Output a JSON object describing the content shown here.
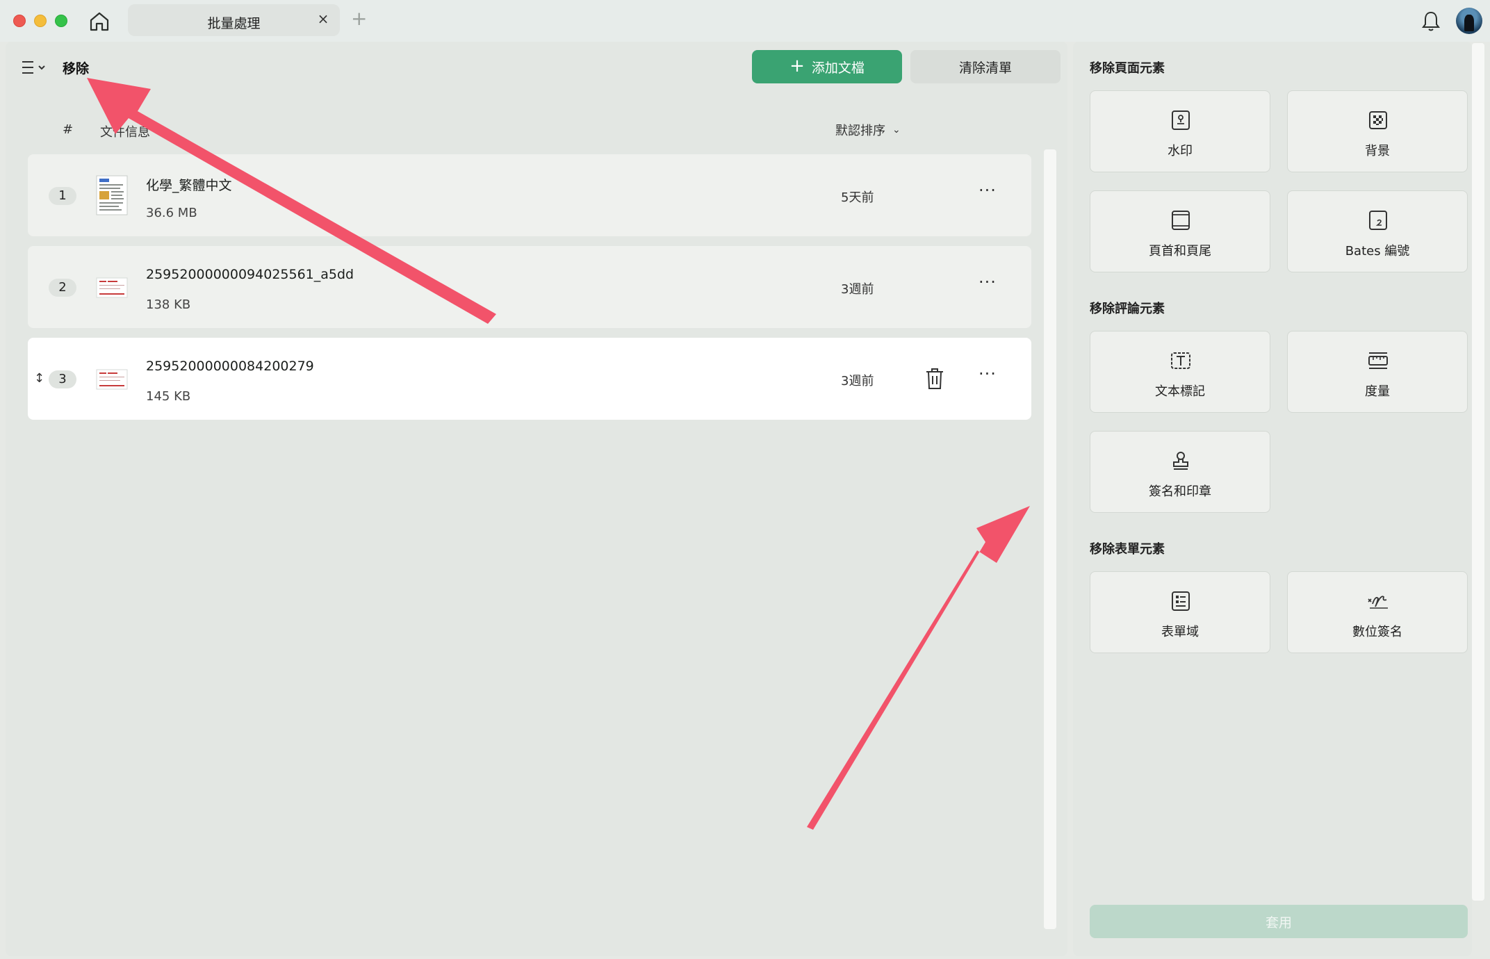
{
  "tab": {
    "title": "批量處理",
    "close": "×",
    "add": "+"
  },
  "header": {
    "title": "移除",
    "add_button": "添加文檔",
    "add_plus": "+",
    "clear_button": "清除清單"
  },
  "list": {
    "col_num": "#",
    "col_info": "文件信息",
    "sort_label": "默認排序",
    "sort_chevron": "⌄",
    "rows": [
      {
        "num": "1",
        "name": "化學_繁體中文",
        "size": "36.6 MB",
        "time": "5天前",
        "more": "···"
      },
      {
        "num": "2",
        "name": "25952000000094025561_a5dd",
        "size": "138 KB",
        "time": "3週前",
        "more": "···"
      },
      {
        "num": "3",
        "name": "25952000000084200279",
        "size": "145 KB",
        "time": "3週前",
        "more": "···",
        "drag": "↕"
      }
    ]
  },
  "side": {
    "sections": [
      {
        "title": "移除頁面元素"
      },
      {
        "title": "移除評論元素"
      },
      {
        "title": "移除表單元素"
      }
    ],
    "cards": {
      "watermark": "水印",
      "background": "背景",
      "header_footer": "頁首和頁尾",
      "bates": "Bates 編號",
      "text_markup": "文本標記",
      "measure": "度量",
      "sign_stamp": "簽名和印章",
      "form_field": "表單域",
      "digital_sign": "數位簽名"
    },
    "apply": "套用"
  },
  "colors": {
    "accent": "#3aa372",
    "apply_disabled": "#bcd8ca",
    "annotation_arrow": "#f2536a"
  }
}
